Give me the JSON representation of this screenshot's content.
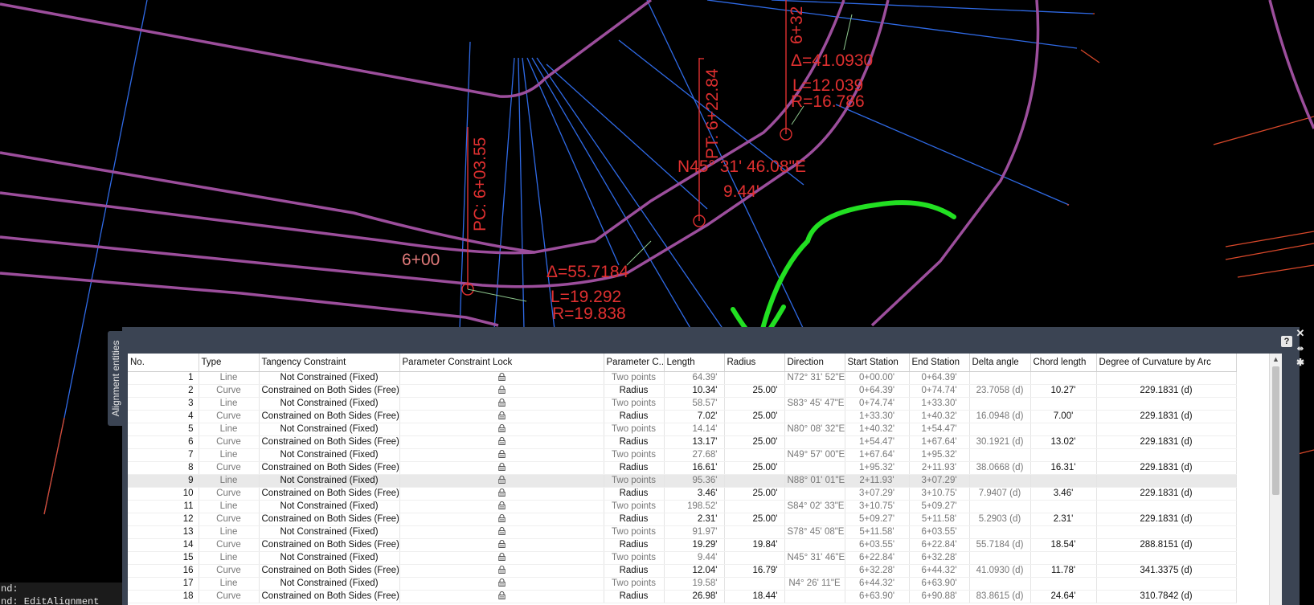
{
  "colors": {
    "background": "#000000",
    "road_edge": "#9c4e9c",
    "grid_line": "#2f6ae6",
    "label": "#e03030",
    "annotation": "#22e022",
    "panel": "#3b4453"
  },
  "drawing": {
    "labels": {
      "sta_600": "6+00",
      "pc_label": "PC: 6+03.55",
      "delta_1": "Δ=55.7184",
      "len_1": "L=19.292",
      "rad_1": "R=19.838",
      "pt_label": "PT: 6+22.84",
      "bearing": "N45° 31' 46.08\"E",
      "dist": "9.44'",
      "sta_632": "6+32",
      "delta_2": "Δ=41.0930",
      "len_2": "L=12.039",
      "rad_2": "R=16.786"
    }
  },
  "command_line": {
    "line1": "nd:",
    "line2": "nd: EditAlignment"
  },
  "panel": {
    "tab_label": "Alignment entities",
    "help_icon": "question-icon",
    "close_icon": "close-icon",
    "pin_icon": "pin-icon",
    "settings_icon": "gear-icon",
    "columns": [
      "No.",
      "Type",
      "Tangency Constraint",
      "Parameter Constraint Lock",
      "Parameter C...",
      "Length",
      "Radius",
      "Direction",
      "Start Station",
      "End Station",
      "Delta angle",
      "Chord length",
      "Degree of Curvature by Arc"
    ],
    "rows": [
      {
        "no": "1",
        "type": "Line",
        "tangency": "Not Constrained (Fixed)",
        "param_c": "Two points",
        "length": "64.39'",
        "radius": "",
        "direction": "N72° 31' 52\"E",
        "start": "0+00.00'",
        "end": "0+64.39'",
        "delta": "",
        "chord": "",
        "doc": ""
      },
      {
        "no": "2",
        "type": "Curve",
        "tangency": "Constrained on Both Sides (Free)",
        "param_c": "Radius",
        "length": "10.34'",
        "radius": "25.00'",
        "direction": "",
        "start": "0+64.39'",
        "end": "0+74.74'",
        "delta": "23.7058 (d)",
        "chord": "10.27'",
        "doc": "229.1831 (d)"
      },
      {
        "no": "3",
        "type": "Line",
        "tangency": "Not Constrained (Fixed)",
        "param_c": "Two points",
        "length": "58.57'",
        "radius": "",
        "direction": "S83° 45' 47\"E",
        "start": "0+74.74'",
        "end": "1+33.30'",
        "delta": "",
        "chord": "",
        "doc": ""
      },
      {
        "no": "4",
        "type": "Curve",
        "tangency": "Constrained on Both Sides (Free)",
        "param_c": "Radius",
        "length": "7.02'",
        "radius": "25.00'",
        "direction": "",
        "start": "1+33.30'",
        "end": "1+40.32'",
        "delta": "16.0948 (d)",
        "chord": "7.00'",
        "doc": "229.1831 (d)"
      },
      {
        "no": "5",
        "type": "Line",
        "tangency": "Not Constrained (Fixed)",
        "param_c": "Two points",
        "length": "14.14'",
        "radius": "",
        "direction": "N80° 08' 32\"E",
        "start": "1+40.32'",
        "end": "1+54.47'",
        "delta": "",
        "chord": "",
        "doc": ""
      },
      {
        "no": "6",
        "type": "Curve",
        "tangency": "Constrained on Both Sides (Free)",
        "param_c": "Radius",
        "length": "13.17'",
        "radius": "25.00'",
        "direction": "",
        "start": "1+54.47'",
        "end": "1+67.64'",
        "delta": "30.1921 (d)",
        "chord": "13.02'",
        "doc": "229.1831 (d)"
      },
      {
        "no": "7",
        "type": "Line",
        "tangency": "Not Constrained (Fixed)",
        "param_c": "Two points",
        "length": "27.68'",
        "radius": "",
        "direction": "N49° 57' 00\"E",
        "start": "1+67.64'",
        "end": "1+95.32'",
        "delta": "",
        "chord": "",
        "doc": ""
      },
      {
        "no": "8",
        "type": "Curve",
        "tangency": "Constrained on Both Sides (Free)",
        "param_c": "Radius",
        "length": "16.61'",
        "radius": "25.00'",
        "direction": "",
        "start": "1+95.32'",
        "end": "2+11.93'",
        "delta": "38.0668 (d)",
        "chord": "16.31'",
        "doc": "229.1831 (d)"
      },
      {
        "no": "9",
        "type": "Line",
        "tangency": "Not Constrained (Fixed)",
        "param_c": "Two points",
        "length": "95.36'",
        "radius": "",
        "direction": "N88° 01' 01\"E",
        "start": "2+11.93'",
        "end": "3+07.29'",
        "delta": "",
        "chord": "",
        "doc": ""
      },
      {
        "no": "10",
        "type": "Curve",
        "tangency": "Constrained on Both Sides (Free)",
        "param_c": "Radius",
        "length": "3.46'",
        "radius": "25.00'",
        "direction": "",
        "start": "3+07.29'",
        "end": "3+10.75'",
        "delta": "7.9407 (d)",
        "chord": "3.46'",
        "doc": "229.1831 (d)"
      },
      {
        "no": "11",
        "type": "Line",
        "tangency": "Not Constrained (Fixed)",
        "param_c": "Two points",
        "length": "198.52'",
        "radius": "",
        "direction": "S84° 02' 33\"E",
        "start": "3+10.75'",
        "end": "5+09.27'",
        "delta": "",
        "chord": "",
        "doc": ""
      },
      {
        "no": "12",
        "type": "Curve",
        "tangency": "Constrained on Both Sides (Free)",
        "param_c": "Radius",
        "length": "2.31'",
        "radius": "25.00'",
        "direction": "",
        "start": "5+09.27'",
        "end": "5+11.58'",
        "delta": "5.2903 (d)",
        "chord": "2.31'",
        "doc": "229.1831 (d)"
      },
      {
        "no": "13",
        "type": "Line",
        "tangency": "Not Constrained (Fixed)",
        "param_c": "Two points",
        "length": "91.97'",
        "radius": "",
        "direction": "S78° 45' 08\"E",
        "start": "5+11.58'",
        "end": "6+03.55'",
        "delta": "",
        "chord": "",
        "doc": ""
      },
      {
        "no": "14",
        "type": "Curve",
        "tangency": "Constrained on Both Sides (Free)",
        "param_c": "Radius",
        "length": "19.29'",
        "radius": "19.84'",
        "direction": "",
        "start": "6+03.55'",
        "end": "6+22.84'",
        "delta": "55.7184 (d)",
        "chord": "18.54'",
        "doc": "288.8151 (d)"
      },
      {
        "no": "15",
        "type": "Line",
        "tangency": "Not Constrained (Fixed)",
        "param_c": "Two points",
        "length": "9.44'",
        "radius": "",
        "direction": "N45° 31' 46\"E",
        "start": "6+22.84'",
        "end": "6+32.28'",
        "delta": "",
        "chord": "",
        "doc": ""
      },
      {
        "no": "16",
        "type": "Curve",
        "tangency": "Constrained on Both Sides (Free)",
        "param_c": "Radius",
        "length": "12.04'",
        "radius": "16.79'",
        "direction": "",
        "start": "6+32.28'",
        "end": "6+44.32'",
        "delta": "41.0930 (d)",
        "chord": "11.78'",
        "doc": "341.3375 (d)"
      },
      {
        "no": "17",
        "type": "Line",
        "tangency": "Not Constrained (Fixed)",
        "param_c": "Two points",
        "length": "19.58'",
        "radius": "",
        "direction": "N4° 26' 11\"E",
        "start": "6+44.32'",
        "end": "6+63.90'",
        "delta": "",
        "chord": "",
        "doc": ""
      },
      {
        "no": "18",
        "type": "Curve",
        "tangency": "Constrained on Both Sides (Free)",
        "param_c": "Radius",
        "length": "26.98'",
        "radius": "18.44'",
        "direction": "",
        "start": "6+63.90'",
        "end": "6+90.88'",
        "delta": "83.8615 (d)",
        "chord": "24.64'",
        "doc": "310.7842 (d)"
      }
    ]
  }
}
